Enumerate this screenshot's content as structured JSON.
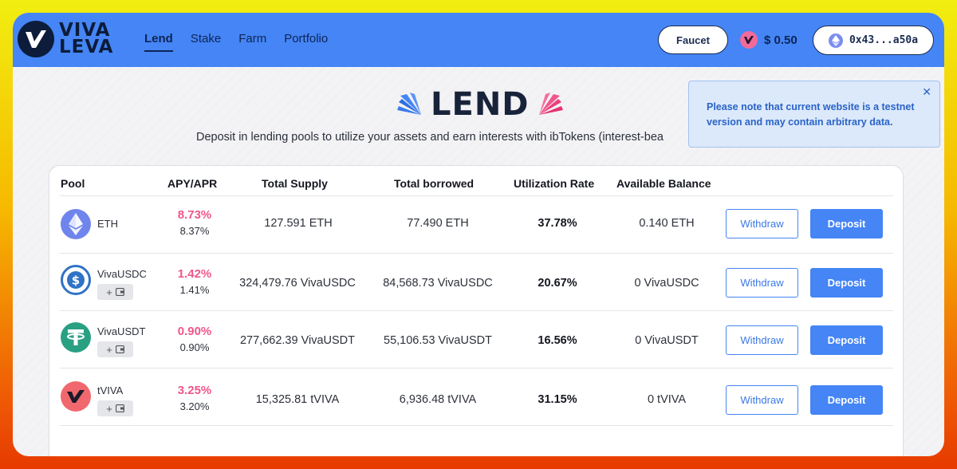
{
  "colors": {
    "accent": "#4585f5",
    "navy": "#0d2456",
    "apy_pink": "#f0568a",
    "notice_bg": "#dce9fb",
    "notice_text": "#2a63c6"
  },
  "header": {
    "logo_line1": "VIVA",
    "logo_line2": "LEVA",
    "nav": [
      {
        "label": "Lend",
        "active": true
      },
      {
        "label": "Stake",
        "active": false
      },
      {
        "label": "Farm",
        "active": false
      },
      {
        "label": "Portfolio",
        "active": false
      }
    ],
    "faucet_label": "Faucet",
    "balance": "$ 0.50",
    "wallet_address": "0x43...a50a"
  },
  "hero": {
    "title": "LEND",
    "subtitle": "Deposit in lending pools to utilize your assets and earn interests with ibTokens (interest-bea"
  },
  "notice": {
    "text": "Please note that current website is a testnet version and may contain arbitrary data.",
    "close_icon": "close-icon"
  },
  "table": {
    "columns": [
      "Pool",
      "APY/APR",
      "Total Supply",
      "Total borrowed",
      "Utilization Rate",
      "Available Balance"
    ],
    "rows": [
      {
        "asset": "ETH",
        "icon": "eth-icon",
        "apy": "8.73%",
        "apr": "8.37%",
        "total_supply": "127.591 ETH",
        "total_borrowed": "77.490 ETH",
        "utilization": "37.78%",
        "available": "0.140 ETH",
        "withdraw": "Withdraw",
        "deposit": "Deposit",
        "add_wallet": "+"
      },
      {
        "asset": "VivaUSDC",
        "icon": "usdc-icon",
        "apy": "1.42%",
        "apr": "1.41%",
        "total_supply": "324,479.76 VivaUSDC",
        "total_borrowed": "84,568.73 VivaUSDC",
        "utilization": "20.67%",
        "available": "0 VivaUSDC",
        "withdraw": "Withdraw",
        "deposit": "Deposit",
        "add_wallet": "+"
      },
      {
        "asset": "VivaUSDT",
        "icon": "usdt-icon",
        "apy": "0.90%",
        "apr": "0.90%",
        "total_supply": "277,662.39 VivaUSDT",
        "total_borrowed": "55,106.53 VivaUSDT",
        "utilization": "16.56%",
        "available": "0 VivaUSDT",
        "withdraw": "Withdraw",
        "deposit": "Deposit",
        "add_wallet": "+"
      },
      {
        "asset": "tVIVA",
        "icon": "viva-icon",
        "apy": "3.25%",
        "apr": "3.20%",
        "total_supply": "15,325.81 tVIVA",
        "total_borrowed": "6,936.48 tVIVA",
        "utilization": "31.15%",
        "available": "0 tVIVA",
        "withdraw": "Withdraw",
        "deposit": "Deposit",
        "add_wallet": "+"
      }
    ]
  }
}
